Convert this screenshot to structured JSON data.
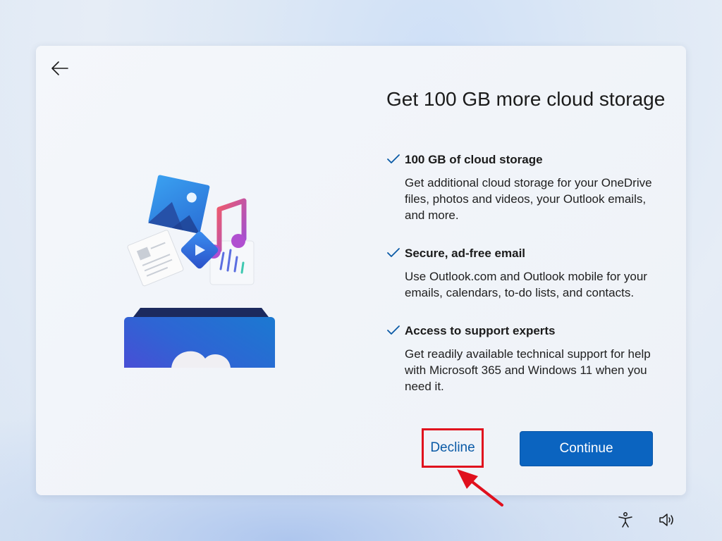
{
  "title": "Get 100 GB more cloud storage",
  "features": [
    {
      "title": "100 GB of cloud storage",
      "desc": "Get additional cloud storage for your OneDrive files, photos and videos, your Outlook emails, and more."
    },
    {
      "title": "Secure, ad-free email",
      "desc": "Use Outlook.com and Outlook mobile for your emails, calendars, to-do lists, and contacts."
    },
    {
      "title": "Access to support experts",
      "desc": "Get readily available technical support for help with Microsoft 365 and Windows 11 when you need it."
    }
  ],
  "buttons": {
    "decline": "Decline",
    "continue": "Continue"
  },
  "icons": {
    "back": "back-arrow-icon",
    "check": "checkmark-icon",
    "accessibility": "accessibility-icon",
    "volume": "volume-icon",
    "annotation": "red-pointer-arrow"
  },
  "colors": {
    "accent": "#0b64c0",
    "link": "#0a5aa6",
    "highlight": "#e0101d",
    "check": "#0a5aa6"
  }
}
